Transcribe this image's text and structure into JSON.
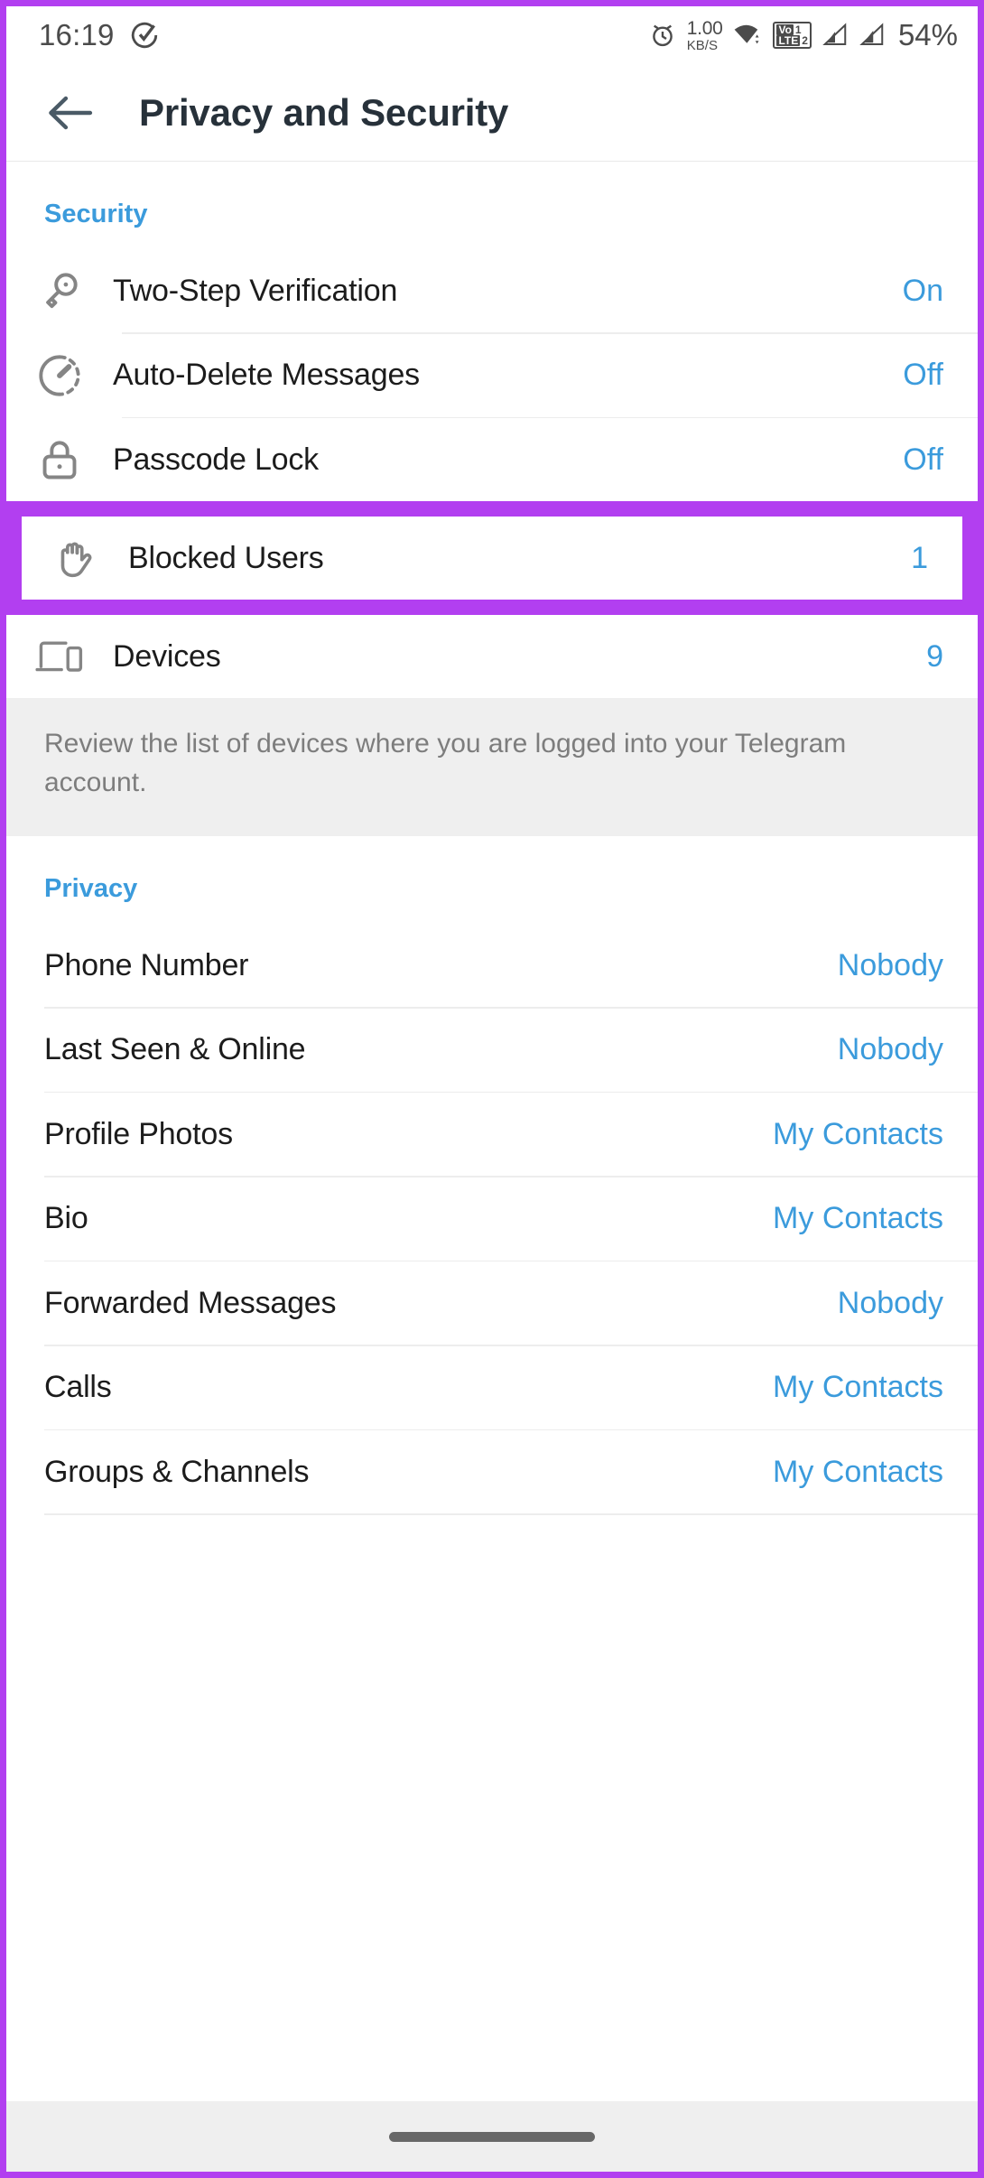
{
  "status_bar": {
    "time": "16:19",
    "check_icon": "check-circle-icon",
    "alarm_icon": "alarm-clock-icon",
    "net_speed_value": "1.00",
    "net_speed_unit": "KB/S",
    "wifi_icon": "wifi-icon",
    "volte_label": "Vo",
    "volte_lte": "LTE",
    "volte_sim1": "1",
    "volte_sim2": "2",
    "signal_icon_1": "signal-bars-icon",
    "signal_icon_2": "signal-bars-icon",
    "battery": "54%"
  },
  "header": {
    "back_icon": "back-arrow-icon",
    "title": "Privacy and Security"
  },
  "security": {
    "section_label": "Security",
    "rows": [
      {
        "icon": "key-icon",
        "label": "Two-Step Verification",
        "value": "On"
      },
      {
        "icon": "timer-icon",
        "label": "Auto-Delete Messages",
        "value": "Off"
      },
      {
        "icon": "padlock-icon",
        "label": "Passcode Lock",
        "value": "Off"
      },
      {
        "icon": "hand-stop-icon",
        "label": "Blocked Users",
        "value": "1"
      },
      {
        "icon": "devices-icon",
        "label": "Devices",
        "value": "9"
      }
    ],
    "devices_note": "Review the list of devices where you are logged into your Telegram account."
  },
  "privacy": {
    "section_label": "Privacy",
    "rows": [
      {
        "label": "Phone Number",
        "value": "Nobody"
      },
      {
        "label": "Last Seen & Online",
        "value": "Nobody"
      },
      {
        "label": "Profile Photos",
        "value": "My Contacts"
      },
      {
        "label": "Bio",
        "value": "My Contacts"
      },
      {
        "label": "Forwarded Messages",
        "value": "Nobody"
      },
      {
        "label": "Calls",
        "value": "My Contacts"
      },
      {
        "label": "Groups & Channels",
        "value": "My Contacts"
      }
    ]
  },
  "annotation": {
    "highlight_color": "#b23ff0",
    "highlight_target": "Blocked Users"
  },
  "colors": {
    "accent_blue": "#3b9bdc",
    "text_primary": "#1c1c1c",
    "text_muted": "#7d7d7d",
    "icon_gray": "#808080",
    "divider": "#ededed",
    "note_bg": "#efefef"
  },
  "gesture_bar": {
    "name": "home-indicator"
  }
}
